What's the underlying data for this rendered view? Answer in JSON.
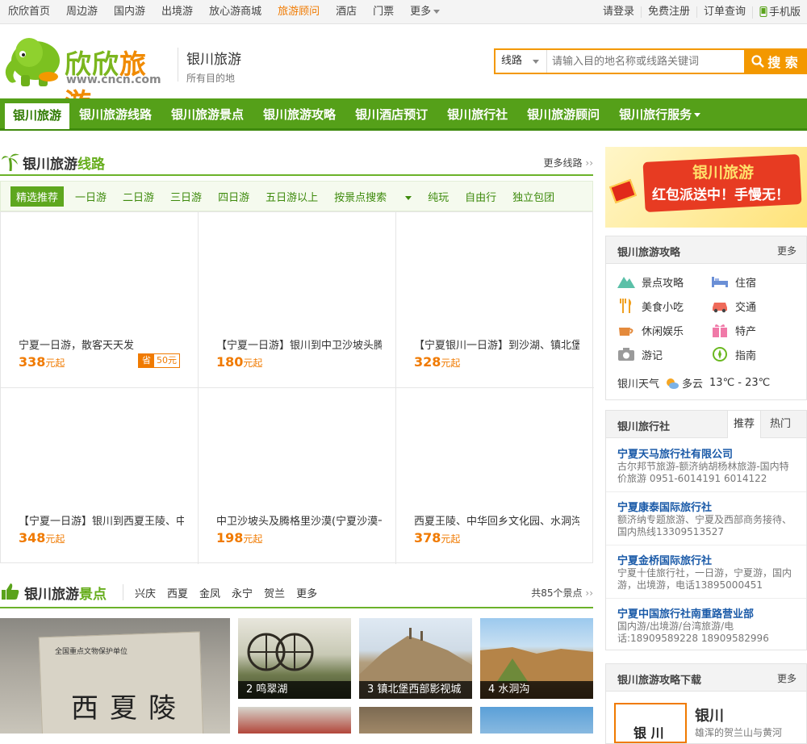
{
  "topbar": {
    "left": [
      "欣欣首页",
      "周边游",
      "国内游",
      "出境游",
      "放心游商城",
      "旅游顾问",
      "酒店",
      "门票",
      "更多"
    ],
    "active_index": 5,
    "right": [
      "请登录",
      "免费注册",
      "订单查询",
      "手机版"
    ]
  },
  "header": {
    "brand_a": "欣欣",
    "brand_b": "旅游",
    "url": "www.cncn.com",
    "city_title": "银川旅游",
    "city_sub": "所有目的地"
  },
  "search": {
    "type": "线路",
    "placeholder": "请输入目的地名称或线路关键词",
    "button": "搜 索"
  },
  "nav": [
    "银川旅游",
    "银川旅游线路",
    "银川旅游景点",
    "银川旅游攻略",
    "银川酒店预订",
    "银川旅行社",
    "银川旅游顾问",
    "银川旅行服务"
  ],
  "routes": {
    "title_a": "银川旅游",
    "title_b": "线路",
    "more": "更多线路",
    "tabs": [
      "精选推荐",
      "一日游",
      "二日游",
      "三日游",
      "四日游",
      "五日游以上",
      "按景点搜索",
      "纯玩",
      "自由行",
      "独立包团"
    ],
    "items": [
      {
        "name": "宁夏一日游，散客天天发",
        "price": "338",
        "unit": "元起",
        "save_tag": "省",
        "save_amt": "50元"
      },
      {
        "name": "【宁夏一日游】银川到中卫沙坡头腾",
        "price": "180",
        "unit": "元起"
      },
      {
        "name": "【宁夏银川一日游】到沙湖、镇北堡",
        "price": "328",
        "unit": "元起"
      },
      {
        "name": "【宁夏一日游】银川到西夏王陵、中",
        "price": "348",
        "unit": "元起"
      },
      {
        "name": "中卫沙坡头及腾格里沙漠(宁夏沙漠一",
        "price": "198",
        "unit": "元起"
      },
      {
        "name": "西夏王陵、中华回乡文化园、水洞沟",
        "price": "378",
        "unit": "元起"
      }
    ]
  },
  "scenic": {
    "title_a": "银川旅游",
    "title_b": "景点",
    "links": [
      "兴庆",
      "西夏",
      "金凤",
      "永宁",
      "贺兰",
      "更多"
    ],
    "count": "共85个景点",
    "big_text": "西夏陵",
    "big_sub": "全国重点文物保护单位",
    "pics": [
      {
        "label": "2  鸣翠湖"
      },
      {
        "label": "3  镇北堡西部影视城"
      },
      {
        "label": "4  水洞沟"
      }
    ]
  },
  "banner": {
    "t1": "银川旅游",
    "t2": "红包派送中！手慢无！"
  },
  "guide": {
    "title": "银川旅游攻略",
    "more": "更多",
    "items": [
      "景点攻略",
      "住宿",
      "美食小吃",
      "交通",
      "休闲娱乐",
      "特产",
      "游记",
      "指南"
    ],
    "weather_label": "银川天气",
    "weather": "多云",
    "temp": "13℃ - 23℃"
  },
  "agency": {
    "title": "银川旅行社",
    "tabs": [
      "推荐",
      "热门"
    ],
    "items": [
      {
        "name": "宁夏天马旅行社有限公司",
        "desc1": "古尔邦节旅游-额济纳胡杨林旅游-国内特",
        "desc2": "价旅游  0951-6014191 6014122"
      },
      {
        "name": "宁夏康泰国际旅行社",
        "desc1": "额济纳专题旅游、宁夏及西部商务接待、",
        "desc2": "国内热线13309513527"
      },
      {
        "name": "宁夏金桥国际旅行社",
        "desc1": "宁夏十佳旅行社，一日游，宁夏游，国内",
        "desc2": "游，出境游，电话13895000451"
      },
      {
        "name": "宁夏中国旅行社南重路营业部",
        "desc1": "国内游/出境游/台湾旅游/电",
        "desc2": "话:18909589228  18909582996"
      }
    ]
  },
  "download": {
    "title": "银川旅游攻略下载",
    "more": "更多",
    "book_title": "银川",
    "book_cover": "银 川",
    "book_desc": "雄浑的贺兰山与黄河"
  },
  "colors": {
    "green": "#55a019",
    "orange": "#f39800",
    "link_blue": "#1a5aa8"
  }
}
